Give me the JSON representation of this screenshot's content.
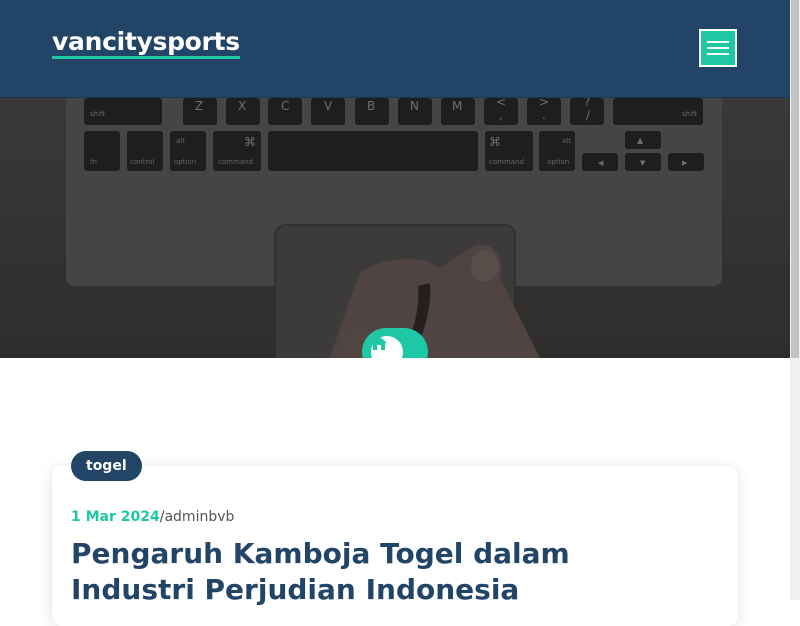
{
  "header": {
    "logo_text": "vancitysports",
    "background": "#224466",
    "accent": "#1ec8a5",
    "menu_icon": "hamburger-icon"
  },
  "hero": {
    "home_icon": "home-icon",
    "keyboard": {
      "row1": [
        "shift",
        "Z",
        "X",
        "C",
        "V",
        "B",
        "N",
        "M",
        "<",
        ">",
        "?",
        "shift"
      ],
      "row1_sub": [
        ",",
        ".",
        "/"
      ],
      "row2": [
        "fn",
        "control",
        "option",
        "command",
        "command",
        "option"
      ],
      "row2_top": [
        "alt",
        "⌘",
        "⌘",
        "alt"
      ]
    }
  },
  "post": {
    "category": "togel",
    "date": "1 Mar 2024",
    "separator": "/",
    "author": "adminbvb",
    "title": "Pengaruh Kamboja Togel dalam Industri Perjudian Indonesia"
  }
}
